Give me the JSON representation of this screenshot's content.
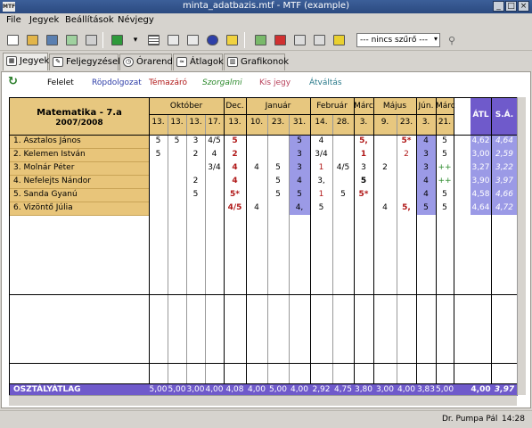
{
  "window": {
    "title": "minta_adatbazis.mtf - MTF (example)",
    "app_icon": "MTF"
  },
  "menu": [
    "File",
    "Jegyek",
    "Beállítások",
    "Névjegy"
  ],
  "filter": {
    "value": "--- nincs szűrő ---"
  },
  "tabs": [
    "Jegyek",
    "Feljegyzések",
    "Órarend",
    "Átlagok",
    "Grafikonok"
  ],
  "legend": [
    {
      "label": "Felelet",
      "color": "#000000"
    },
    {
      "label": "Röpdolgozat",
      "color": "#2d3da8"
    },
    {
      "label": "Témazáró",
      "color": "#b01818"
    },
    {
      "label": "Szorgalmi",
      "color": "#2c8a2c"
    },
    {
      "label": "Kis jegy",
      "color": "#b8405a"
    },
    {
      "label": "Átváltás",
      "color": "#2a7a8a"
    }
  ],
  "grid": {
    "subject": "Matematika - 7.a",
    "year": "2007/2008",
    "months": [
      "Október",
      "Dec.",
      "Január",
      "Február",
      "Márc",
      "Május",
      "Jún.",
      "Márc"
    ],
    "days": [
      "13.",
      "13.",
      "13.",
      "17.",
      "13.",
      "10.",
      "23.",
      "31.",
      "14.",
      "28.",
      "3.",
      "9.",
      "23.",
      "3.",
      "21."
    ],
    "col_atl": "ÁTL",
    "col_sa": "S.Á.",
    "students": [
      {
        "name": "1. Asztalos János",
        "grades": [
          "5",
          "5",
          "3",
          "4/5",
          "5",
          "",
          "",
          "5",
          "4",
          "",
          "5,",
          "",
          "5*",
          "4",
          "5"
        ],
        "atl": "4,62",
        "sa": "4,64"
      },
      {
        "name": "2. Kelemen István",
        "grades": [
          "5",
          "",
          "2",
          "4",
          "2",
          "",
          "",
          "3",
          "3/4",
          "",
          "1",
          "",
          "2",
          "3",
          "5"
        ],
        "atl": "3,00",
        "sa": "2,59"
      },
      {
        "name": "3. Molnár Péter",
        "grades": [
          "",
          "",
          "",
          "3/4",
          "4",
          "4",
          "5",
          "3",
          "1",
          "4/5",
          "3",
          "2",
          "",
          "3",
          "++"
        ],
        "atl": "3,27",
        "sa": "3,22"
      },
      {
        "name": "4. Nefelejts Nándor",
        "grades": [
          "",
          "",
          "2",
          "",
          "4",
          "",
          "5",
          "4",
          "3,",
          "",
          "5",
          "",
          "",
          "4",
          "++"
        ],
        "atl": "3,90",
        "sa": "3,97"
      },
      {
        "name": "5. Sanda Gyanú",
        "grades": [
          "",
          "",
          "5",
          "",
          "5*",
          "",
          "5",
          "5",
          "1",
          "5",
          "5*",
          "",
          "",
          "4",
          "5"
        ],
        "atl": "4,58",
        "sa": "4,66"
      },
      {
        "name": "6. Vizöntő Júlia",
        "grades": [
          "",
          "",
          "",
          "",
          "4/5",
          "4",
          "",
          "4,",
          "5",
          "",
          "",
          "4",
          "5,",
          "5",
          "5"
        ],
        "atl": "4,64",
        "sa": "4,72"
      }
    ],
    "footer_label": "OSZTÁLYÁTLAG",
    "footer_values": [
      "5,00",
      "5,00",
      "3,00",
      "4,00",
      "4,08",
      "4,00",
      "5,00",
      "4,00",
      "2,92",
      "4,75",
      "3,80",
      "3,00",
      "4,00",
      "3,83",
      "5,00"
    ],
    "footer_atl": "4,00",
    "footer_sa": "3,97"
  },
  "status": {
    "user": "Dr. Pumpa Pál",
    "time": "14:28"
  },
  "colors": {
    "header": "#e7c77f",
    "name_bg": "#e8c57a",
    "highlight": "#9b9ae6",
    "footer": "#6f5acb"
  }
}
